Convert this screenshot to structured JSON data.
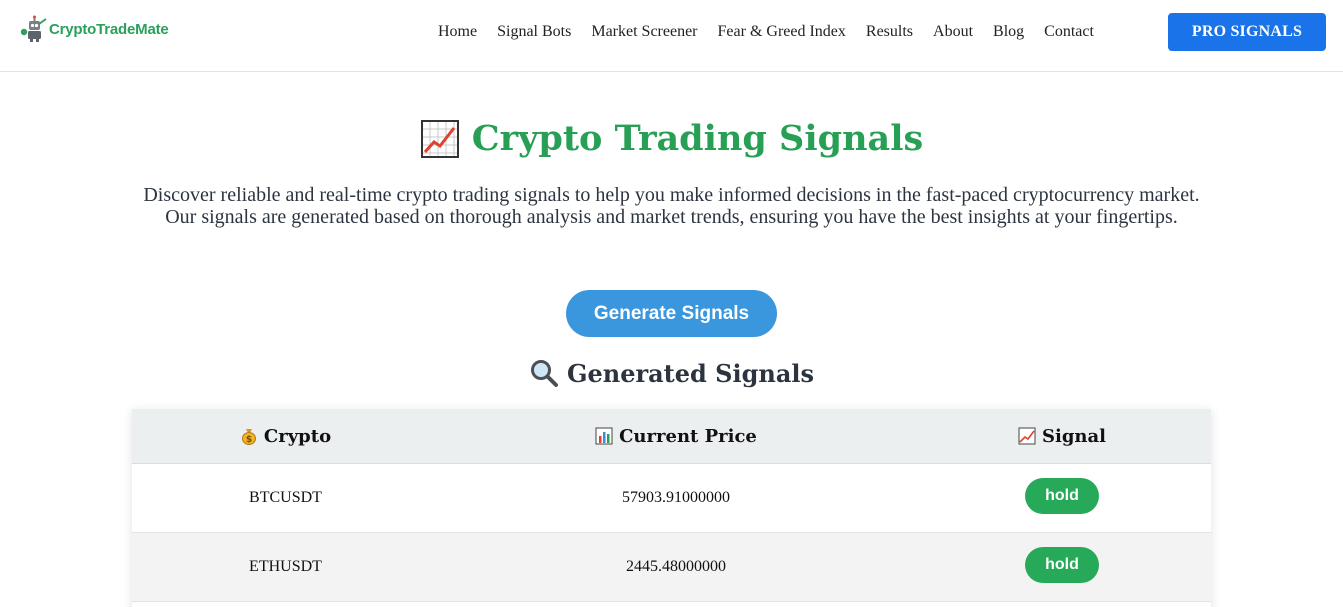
{
  "header": {
    "logo_text": "CryptoTradeMate",
    "nav": [
      "Home",
      "Signal Bots",
      "Market Screener",
      "Fear & Greed Index",
      "Results",
      "About",
      "Blog",
      "Contact"
    ],
    "pro_button": "PRO SIGNALS"
  },
  "hero": {
    "title": "Crypto Trading Signals",
    "title_icon": "chart-increasing-icon",
    "description": "Discover reliable and real-time crypto trading signals to help you make informed decisions in the fast-paced cryptocurrency market. Our signals are generated based on thorough analysis and market trends, ensuring you have the best insights at your fingertips.",
    "generate_button": "Generate Signals",
    "subtitle": "Generated Signals",
    "subtitle_icon": "magnifier-icon"
  },
  "table": {
    "headers": [
      {
        "label": "Crypto",
        "icon": "money-bag-icon"
      },
      {
        "label": "Current Price",
        "icon": "bar-chart-icon"
      },
      {
        "label": "Signal",
        "icon": "chart-increasing-icon"
      }
    ],
    "rows": [
      {
        "crypto": "BTCUSDT",
        "price": "57903.91000000",
        "signal": "hold"
      },
      {
        "crypto": "ETHUSDT",
        "price": "2445.48000000",
        "signal": "hold"
      }
    ]
  },
  "colors": {
    "brand_green": "#27a055",
    "pro_blue": "#1a73e8",
    "generate_blue": "#3a96dd",
    "signal_green": "#27a95a"
  }
}
